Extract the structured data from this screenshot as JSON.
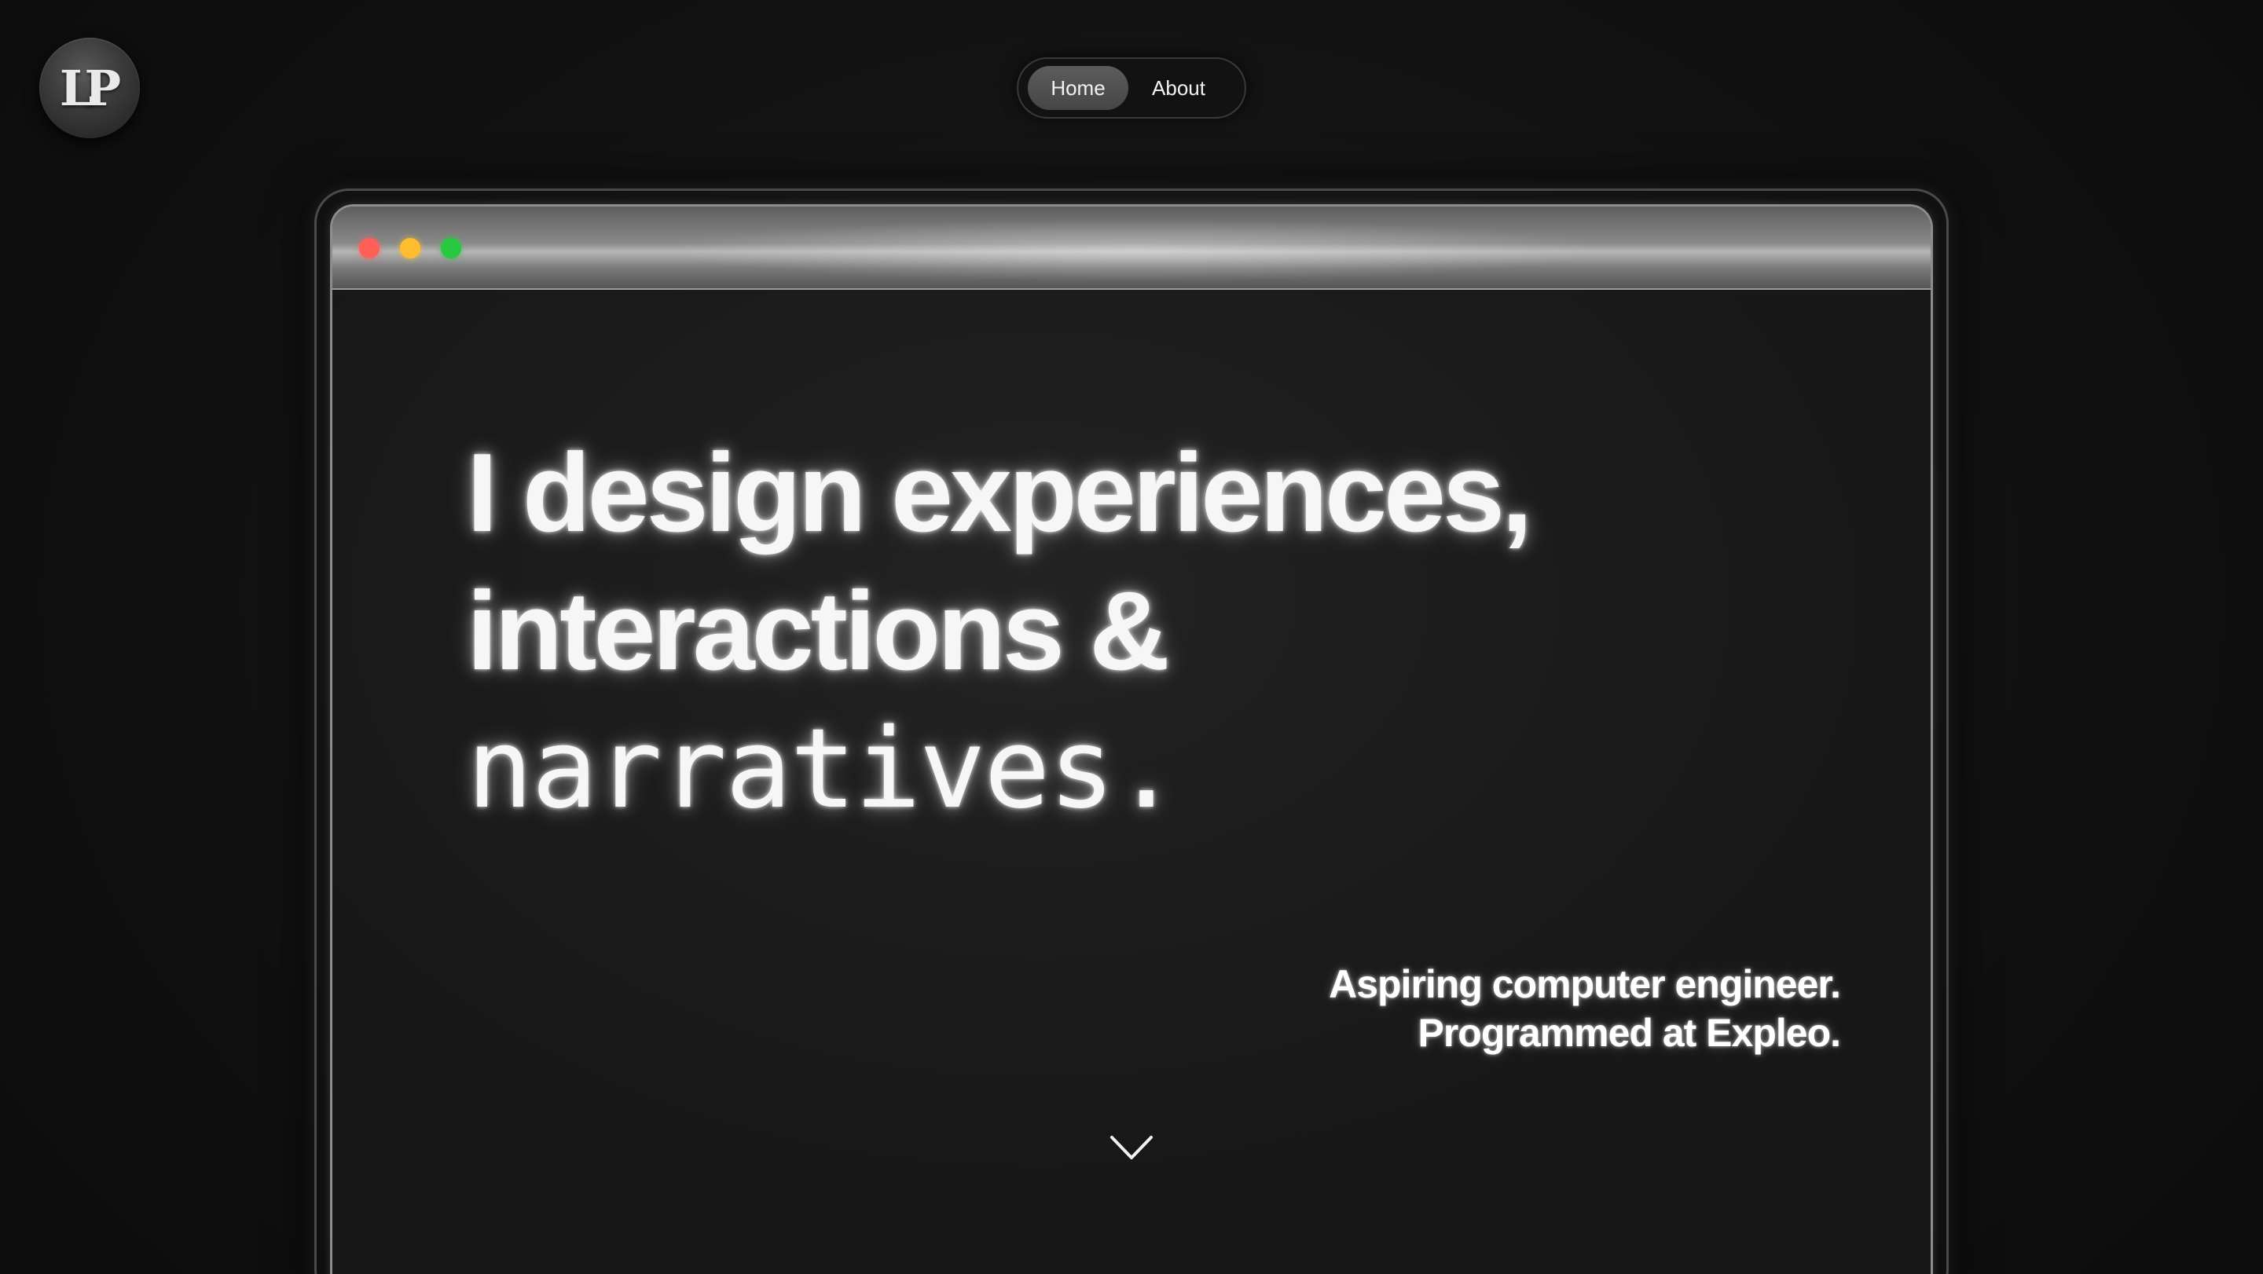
{
  "logo": {
    "text": "LP"
  },
  "nav": {
    "items": [
      {
        "label": "Home",
        "active": true
      },
      {
        "label": "About",
        "active": false
      }
    ]
  },
  "browser_window": {
    "controls": [
      "close",
      "minimize",
      "maximize"
    ],
    "control_colors": {
      "close": "#ff5f57",
      "minimize": "#febc2e",
      "maximize": "#28c840"
    }
  },
  "hero": {
    "line1": "I design experiences,",
    "line2": "interactions &",
    "line3": "narratives."
  },
  "tagline": {
    "line1": "Aspiring computer engineer.",
    "line2": "Programmed at Expleo."
  },
  "scroll_indicator": {
    "icon": "chevron-down-icon"
  },
  "colors": {
    "background": "#0f0f0f",
    "text": "#f6f6f6",
    "nav_active": "#555555"
  }
}
